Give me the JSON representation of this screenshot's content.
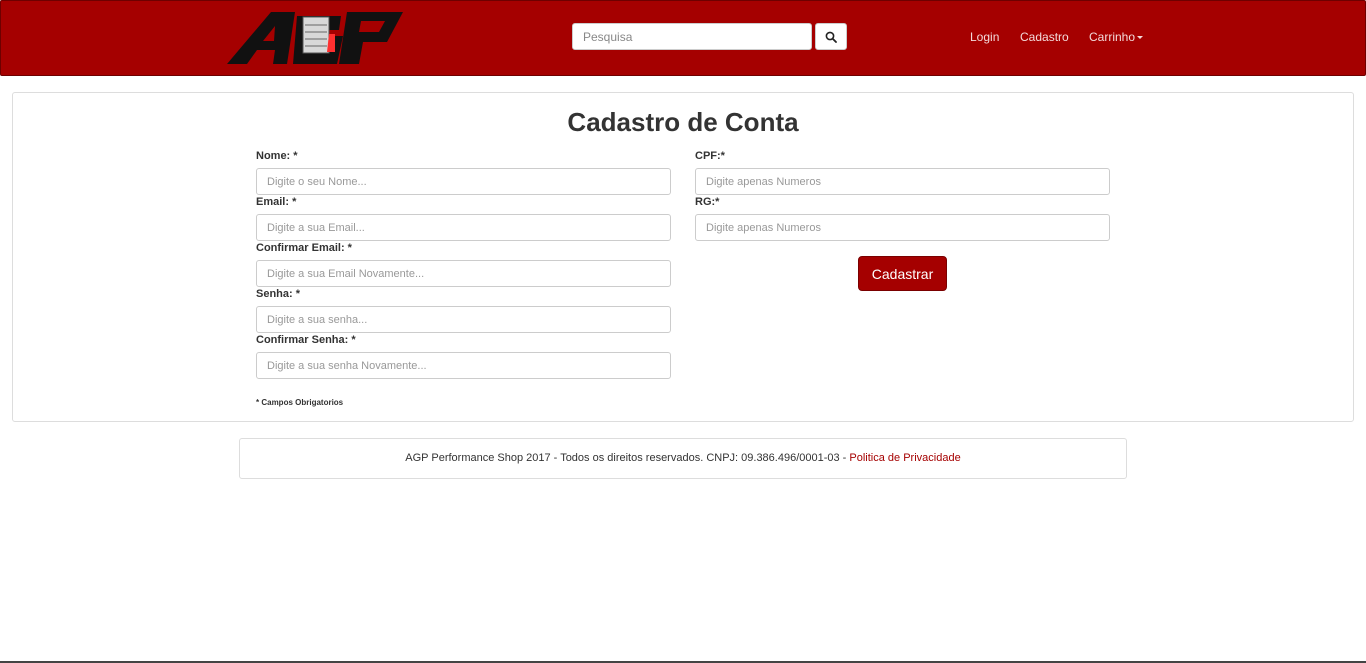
{
  "header": {
    "logo_text": "AGP",
    "search": {
      "placeholder": "Pesquisa",
      "value": ""
    },
    "nav": {
      "login": "Login",
      "cadastro": "Cadastro",
      "carrinho": "Carrinho"
    },
    "brand_color": "#a50000"
  },
  "form": {
    "title": "Cadastro de Conta",
    "fields": {
      "nome": {
        "label": "Nome: *",
        "placeholder": "Digite o seu Nome..."
      },
      "email": {
        "label": "Email: *",
        "placeholder": "Digite a sua Email..."
      },
      "confirm_email": {
        "label": "Confirmar Email: *",
        "placeholder": "Digite a sua Email Novamente..."
      },
      "senha": {
        "label": "Senha: *",
        "placeholder": "Digite a sua senha..."
      },
      "confirm_senha": {
        "label": "Confirmar Senha: *",
        "placeholder": "Digite a sua senha Novamente..."
      },
      "cpf": {
        "label": "CPF:*",
        "placeholder": "Digite apenas Numeros"
      },
      "rg": {
        "label": "RG:*",
        "placeholder": "Digite apenas Numeros"
      }
    },
    "submit_label": "Cadastrar",
    "required_note": "* Campos Obrigatorios"
  },
  "footer": {
    "text": "AGP Performance Shop 2017 - Todos os direitos reservados. CNPJ: 09.386.496/0001-03 - ",
    "privacy_link": "Politica de Privacidade"
  },
  "icons": {
    "search": "search-icon",
    "dropdown": "caret-down-icon"
  }
}
